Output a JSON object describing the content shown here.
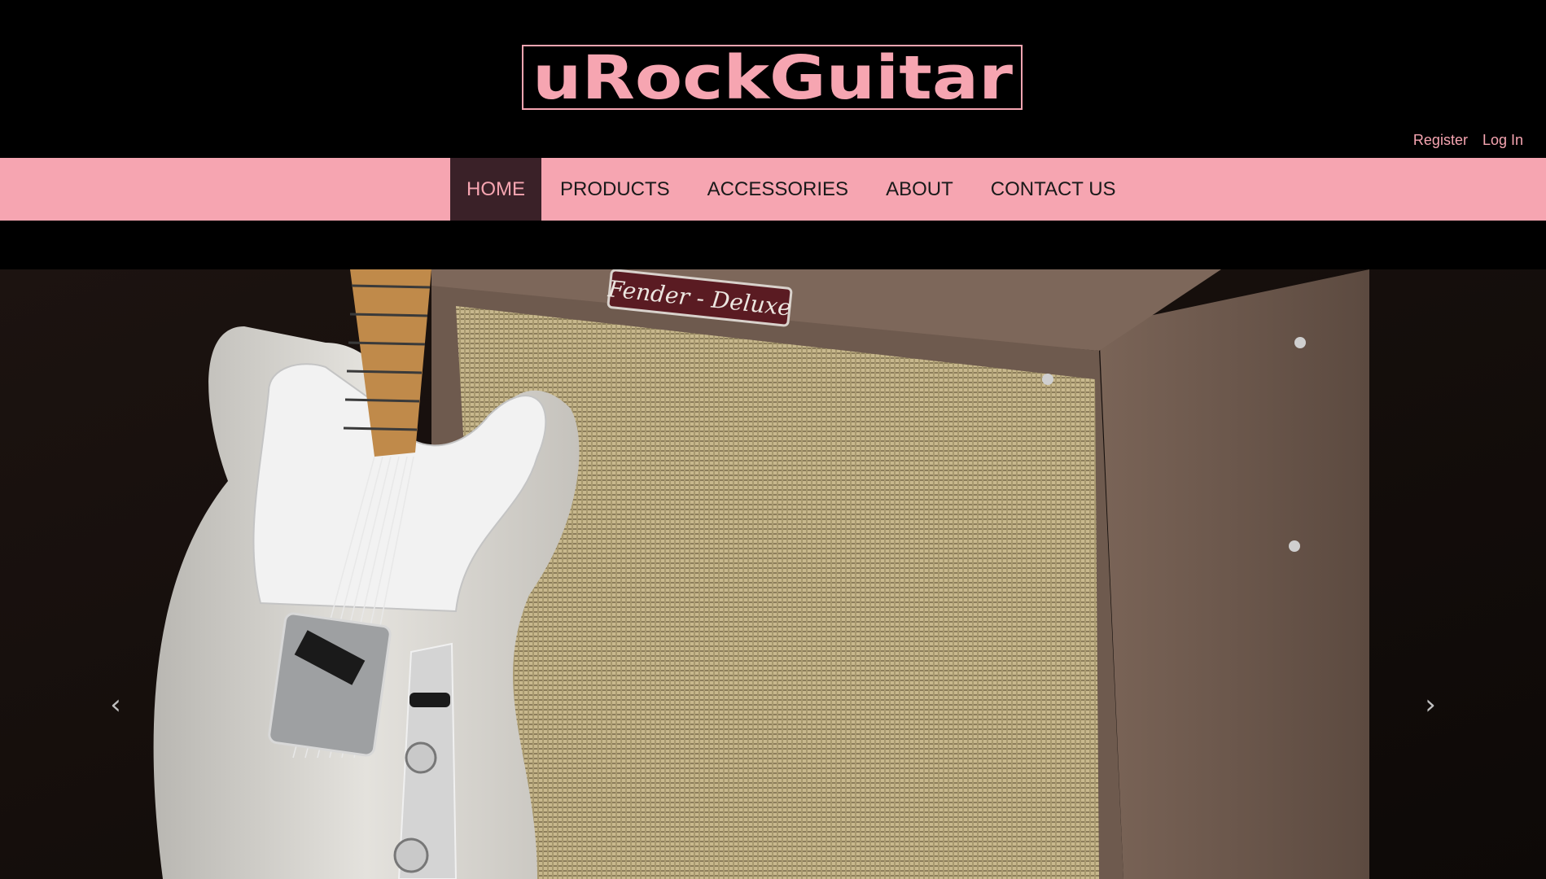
{
  "brand": {
    "logo_text": "uRockGuitar"
  },
  "account": {
    "register": "Register",
    "login": "Log In"
  },
  "nav": {
    "items": [
      {
        "label": "HOME",
        "active": true
      },
      {
        "label": "PRODUCTS",
        "active": false
      },
      {
        "label": "ACCESSORIES",
        "active": false
      },
      {
        "label": "ABOUT",
        "active": false
      },
      {
        "label": "CONTACT US",
        "active": false
      }
    ]
  },
  "hero": {
    "amp_badge": "Fender - Deluxe",
    "prev_icon": "chevron-left-icon",
    "next_icon": "chevron-right-icon"
  },
  "colors": {
    "brand_pink": "#f6a5b1",
    "active_nav_bg": "#3a2128",
    "header_bg": "#000000"
  }
}
